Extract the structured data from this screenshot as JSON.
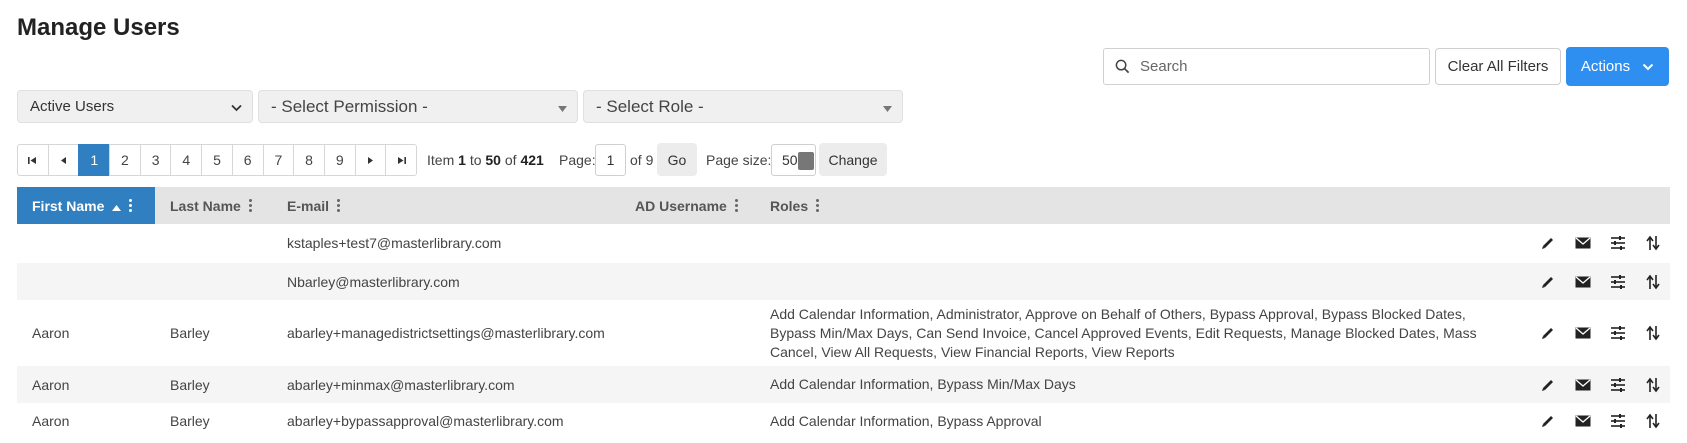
{
  "page": {
    "title": "Manage Users"
  },
  "search": {
    "placeholder": "Search",
    "value": ""
  },
  "buttons": {
    "clear_filters": "Clear All Filters",
    "actions": "Actions"
  },
  "filters": {
    "status": "Active Users",
    "permission": "- Select Permission -",
    "role": "- Select Role -"
  },
  "pager": {
    "pages": [
      "1",
      "2",
      "3",
      "4",
      "5",
      "6",
      "7",
      "8",
      "9"
    ],
    "active_page": "1",
    "item_label": "Item",
    "item_from": "1",
    "to_label": "to",
    "item_to": "50",
    "of_label": "of",
    "total": "421",
    "page_label": "Page:",
    "page_value": "1",
    "page_of": "of 9",
    "go": "Go",
    "size_label": "Page size:",
    "size_value": "50",
    "change": "Change"
  },
  "table": {
    "columns": [
      {
        "label": "First Name",
        "sorted": "asc"
      },
      {
        "label": "Last Name"
      },
      {
        "label": "E-mail"
      },
      {
        "label": "AD Username"
      },
      {
        "label": "Roles"
      }
    ],
    "rows": [
      {
        "first": "",
        "last": "",
        "email": "kstaples+test7@masterlibrary.com",
        "ad": "",
        "roles": ""
      },
      {
        "first": "",
        "last": "",
        "email": "Nbarley@masterlibrary.com",
        "ad": "",
        "roles": ""
      },
      {
        "first": "Aaron",
        "last": "Barley",
        "email": "abarley+managedistrictsettings@masterlibrary.com",
        "ad": "",
        "roles": "Add Calendar Information, Administrator, Approve on Behalf of Others, Bypass Approval, Bypass Blocked Dates, Bypass Min/Max Days, Can Send Invoice, Cancel Approved Events, Edit Requests, Manage Blocked Dates, Mass Cancel, View All Requests, View Financial Reports, View Reports"
      },
      {
        "first": "Aaron",
        "last": "Barley",
        "email": "abarley+minmax@masterlibrary.com",
        "ad": "",
        "roles": "Add Calendar Information, Bypass Min/Max Days"
      },
      {
        "first": "Aaron",
        "last": "Barley",
        "email": "abarley+bypassapproval@masterlibrary.com",
        "ad": "",
        "roles": "Add Calendar Information, Bypass Approval"
      }
    ],
    "row_actions": [
      "pencil-icon",
      "envelope-icon",
      "sliders-icon",
      "sort-arrows-icon"
    ]
  },
  "colors": {
    "primary": "#2f8ff0",
    "sorted_header": "#2f7fc1",
    "header_bg": "#e4e4e4",
    "alt_row": "#f5f5f5"
  }
}
